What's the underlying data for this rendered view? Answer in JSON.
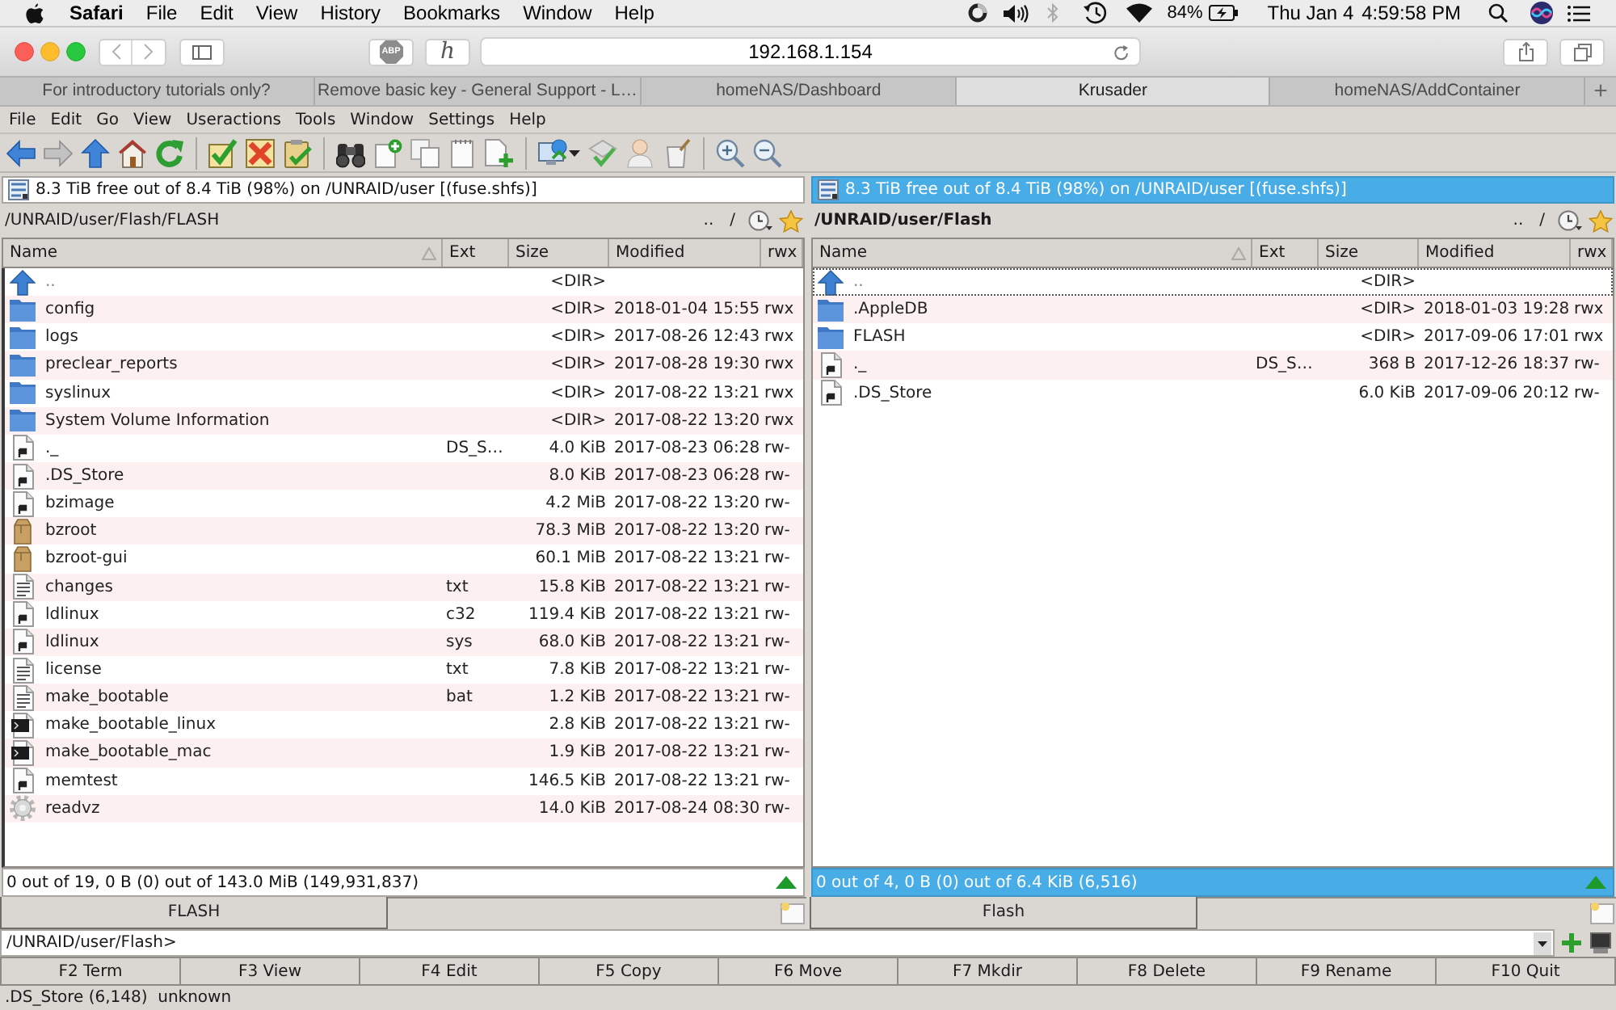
{
  "menubar": {
    "app": "Safari",
    "items": [
      "File",
      "Edit",
      "View",
      "History",
      "Bookmarks",
      "Window",
      "Help"
    ],
    "battery": "84%",
    "date": "Thu Jan 4",
    "time": "4:59:58 PM"
  },
  "browser": {
    "extensions": [
      {
        "kind": "adblock",
        "label": "ABP"
      },
      {
        "kind": "script",
        "label": "h"
      }
    ],
    "address": "192.168.1.154",
    "tabs": [
      {
        "title": "For introductory tutorials only?",
        "selected": false
      },
      {
        "title": "Remove basic key - General Support - L…",
        "selected": false
      },
      {
        "title": "homeNAS/Dashboard",
        "selected": false
      },
      {
        "title": "Krusader",
        "selected": true
      },
      {
        "title": "homeNAS/AddContainer",
        "selected": false
      }
    ],
    "new_tab": "+"
  },
  "krusader": {
    "menu": [
      "File",
      "Edit",
      "Go",
      "View",
      "Useractions",
      "Tools",
      "Window",
      "Settings",
      "Help"
    ],
    "panels": [
      {
        "active": false,
        "free_space": "8.3 TiB free out of 8.4 TiB (98%) on /UNRAID/user [(fuse.shfs)]",
        "path": "/UNRAID/user/Flash/FLASH",
        "path_buttons": [
          "..",
          "/"
        ],
        "columns": [
          {
            "label": "Name",
            "sorted": true
          },
          {
            "label": "Ext",
            "sorted": false
          },
          {
            "label": "Size",
            "sorted": false
          },
          {
            "label": "Modified",
            "sorted": false
          },
          {
            "label": "rwx",
            "sorted": false
          }
        ],
        "rows": [
          {
            "kind": "parent",
            "name": "..",
            "size": "<DIR>",
            "focused": false
          },
          {
            "kind": "folder",
            "name": "config",
            "size": "<DIR>",
            "modified": "2018-01-04 15:55",
            "perms": "rwx",
            "focused": false
          },
          {
            "kind": "folder",
            "name": "logs",
            "size": "<DIR>",
            "modified": "2017-08-26 12:43",
            "perms": "rwx",
            "focused": false
          },
          {
            "kind": "folder",
            "name": "preclear_reports",
            "size": "<DIR>",
            "modified": "2017-08-28 19:30",
            "perms": "rwx",
            "focused": false
          },
          {
            "kind": "folder",
            "name": "syslinux",
            "size": "<DIR>",
            "modified": "2017-08-22 13:21",
            "perms": "rwx",
            "focused": false
          },
          {
            "kind": "folder",
            "name": "System Volume Information",
            "size": "<DIR>",
            "modified": "2017-08-22 13:20",
            "perms": "rwx",
            "focused": false
          },
          {
            "kind": "binary",
            "name": "._",
            "ext": "DS_S…",
            "size": "4.0 KiB",
            "modified": "2017-08-23 06:28",
            "perms": "rw-",
            "focused": false
          },
          {
            "kind": "binary",
            "name": ".DS_Store",
            "size": "8.0 KiB",
            "modified": "2017-08-23 06:28",
            "perms": "rw-",
            "focused": false
          },
          {
            "kind": "binary",
            "name": "bzimage",
            "size": "4.2 MiB",
            "modified": "2017-08-22 13:20",
            "perms": "rw-",
            "focused": false
          },
          {
            "kind": "archive",
            "name": "bzroot",
            "size": "78.3 MiB",
            "modified": "2017-08-22 13:20",
            "perms": "rw-",
            "focused": false
          },
          {
            "kind": "archive",
            "name": "bzroot-gui",
            "size": "60.1 MiB",
            "modified": "2017-08-22 13:21",
            "perms": "rw-",
            "focused": false
          },
          {
            "kind": "text",
            "name": "changes",
            "ext": "txt",
            "size": "15.8 KiB",
            "modified": "2017-08-22 13:21",
            "perms": "rw-",
            "focused": false
          },
          {
            "kind": "binary",
            "name": "ldlinux",
            "ext": "c32",
            "size": "119.4 KiB",
            "modified": "2017-08-22 13:21",
            "perms": "rw-",
            "focused": false
          },
          {
            "kind": "binary",
            "name": "ldlinux",
            "ext": "sys",
            "size": "68.0 KiB",
            "modified": "2017-08-22 13:21",
            "perms": "rw-",
            "focused": false
          },
          {
            "kind": "text",
            "name": "license",
            "ext": "txt",
            "size": "7.8 KiB",
            "modified": "2017-08-22 13:21",
            "perms": "rw-",
            "focused": false
          },
          {
            "kind": "text",
            "name": "make_bootable",
            "ext": "bat",
            "size": "1.2 KiB",
            "modified": "2017-08-22 13:21",
            "perms": "rw-",
            "focused": false
          },
          {
            "kind": "script",
            "name": "make_bootable_linux",
            "size": "2.8 KiB",
            "modified": "2017-08-22 13:21",
            "perms": "rw-",
            "focused": false
          },
          {
            "kind": "script",
            "name": "make_bootable_mac",
            "size": "1.9 KiB",
            "modified": "2017-08-22 13:21",
            "perms": "rw-",
            "focused": false
          },
          {
            "kind": "binary",
            "name": "memtest",
            "size": "146.5 KiB",
            "modified": "2017-08-22 13:21",
            "perms": "rw-",
            "focused": false
          },
          {
            "kind": "settings",
            "name": "readvz",
            "size": "14.0 KiB",
            "modified": "2017-08-24 08:30",
            "perms": "rw-",
            "focused": false
          }
        ],
        "status": "0 out of 19, 0 B (0) out of 143.0 MiB (149,931,837)",
        "tabs": [
          {
            "label": "FLASH",
            "selected": true
          }
        ]
      },
      {
        "active": true,
        "free_space": "8.3 TiB free out of 8.4 TiB (98%) on /UNRAID/user [(fuse.shfs)]",
        "path": "/UNRAID/user/Flash",
        "path_buttons": [
          "..",
          "/"
        ],
        "columns": [
          {
            "label": "Name",
            "sorted": true
          },
          {
            "label": "Ext",
            "sorted": false
          },
          {
            "label": "Size",
            "sorted": false
          },
          {
            "label": "Modified",
            "sorted": false
          },
          {
            "label": "rwx",
            "sorted": false
          }
        ],
        "rows": [
          {
            "kind": "parent",
            "name": "..",
            "size": "<DIR>",
            "focused": true
          },
          {
            "kind": "folder",
            "name": ".AppleDB",
            "size": "<DIR>",
            "modified": "2018-01-03 19:28",
            "perms": "rwx",
            "focused": false
          },
          {
            "kind": "folder",
            "name": "FLASH",
            "size": "<DIR>",
            "modified": "2017-09-06 17:01",
            "perms": "rwx",
            "focused": false
          },
          {
            "kind": "binary",
            "name": "._",
            "ext": "DS_S…",
            "size": "368 B",
            "modified": "2017-12-26 18:37",
            "perms": "rw-",
            "focused": false
          },
          {
            "kind": "binary",
            "name": ".DS_Store",
            "size": "6.0 KiB",
            "modified": "2017-09-06 20:12",
            "perms": "rw-",
            "focused": false
          }
        ],
        "status": "0 out of 4, 0 B (0) out of 6.4 KiB (6,516)",
        "tabs": [
          {
            "label": "Flash",
            "selected": true
          }
        ]
      }
    ],
    "command_line": {
      "prompt": "/UNRAID/user/Flash>"
    },
    "function_keys": [
      "F2 Term",
      "F3 View",
      "F4 Edit",
      "F5 Copy",
      "F6 Move",
      "F7 Mkdir",
      "F8 Delete",
      "F9 Rename",
      "F10 Quit"
    ],
    "status_bar": ".DS_Store (6,148)  unknown"
  }
}
